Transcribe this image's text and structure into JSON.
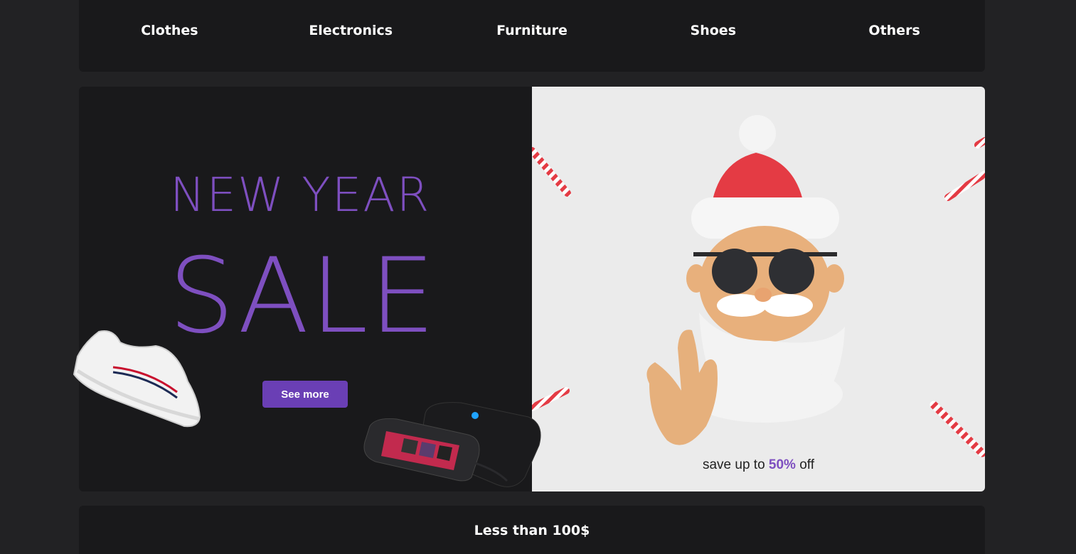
{
  "nav": {
    "categories": [
      "Clothes",
      "Electronics",
      "Furniture",
      "Shoes",
      "Others"
    ]
  },
  "hero": {
    "headline_top": "NEW YEAR",
    "headline_main": "SALE",
    "button_label": "See more",
    "save_prefix": "save up to ",
    "save_percent": "50%",
    "save_suffix": " off",
    "accent_color": "#7e4fc0",
    "button_color": "#6a3fb5",
    "left_bg": "#19191b",
    "right_bg": "#ebebeb"
  },
  "images": {
    "sneaker": "sneaker-icon",
    "console": "handheld-console-icon",
    "santa": "santa-mascot-icon",
    "candy_cane": "candy-cane-icon"
  },
  "section": {
    "title": "Less than 100$"
  },
  "colors": {
    "page_bg": "#222224",
    "panel_bg": "#19191b"
  }
}
